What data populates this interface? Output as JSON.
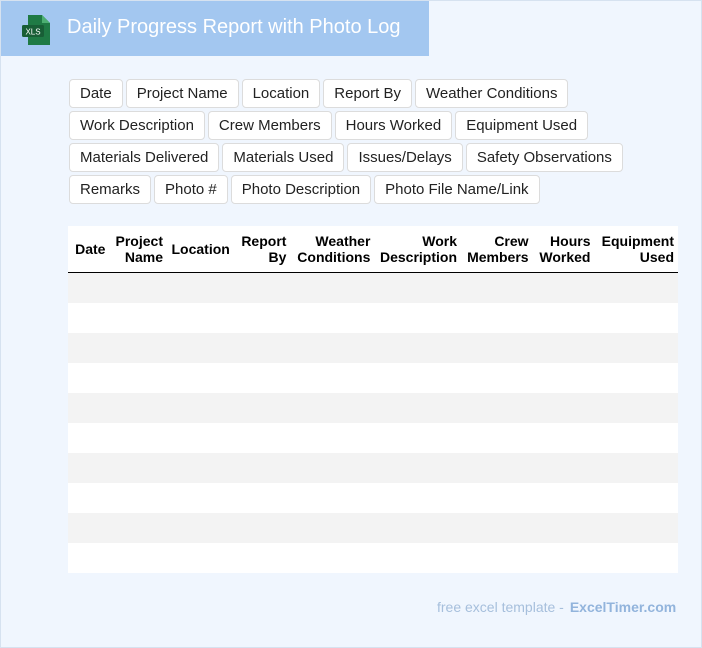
{
  "header": {
    "icon_text": "XLS",
    "title": "Daily Progress Report with Photo Log",
    "colors": {
      "header_bg": "#a3c7f0",
      "icon_green": "#1f7a45"
    }
  },
  "chips": {
    "rows": [
      [
        "Date",
        "Project Name",
        "Location",
        "Report By",
        "Weather Conditions"
      ],
      [
        "Work Description",
        "Crew Members",
        "Hours Worked",
        "Equipment Used"
      ],
      [
        "Materials Delivered",
        "Materials Used",
        "Issues/Delays",
        "Safety Observations"
      ],
      [
        "Remarks",
        "Photo #",
        "Photo Description",
        "Photo File Name/Link"
      ]
    ]
  },
  "table": {
    "columns": [
      [
        "Date"
      ],
      [
        "Project",
        "Name"
      ],
      [
        "Location"
      ],
      [
        "Report",
        "By"
      ],
      [
        "Weather",
        "Conditions"
      ],
      [
        "Work",
        "Description"
      ],
      [
        "Crew",
        "Members"
      ],
      [
        "Hours",
        "Worked"
      ],
      [
        "Equipment",
        "Used"
      ]
    ],
    "row_count": 10
  },
  "footer": {
    "prefix": "free excel template -",
    "brand": "ExcelTimer.com"
  }
}
